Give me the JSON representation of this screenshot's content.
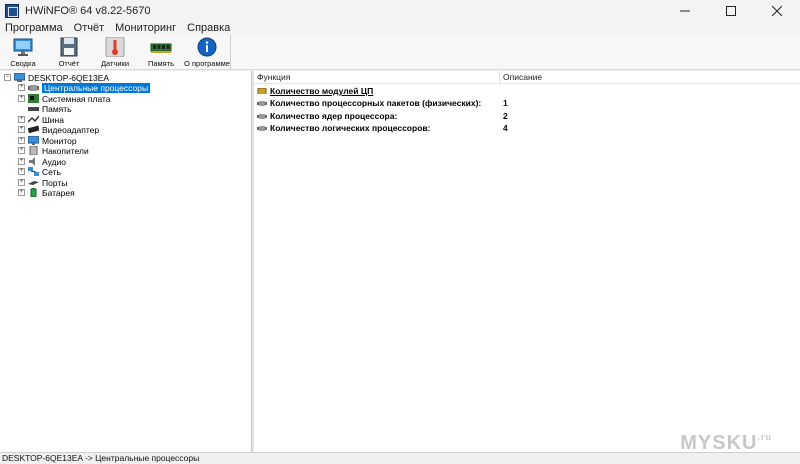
{
  "window": {
    "title": "HWiNFO® 64 v8.22-5670"
  },
  "menu": [
    "Программа",
    "Отчёт",
    "Мониторинг",
    "Справка"
  ],
  "toolbar": {
    "buttons": [
      {
        "label": "Сводка",
        "icon": "monitor-icon"
      },
      {
        "label": "Отчёт",
        "icon": "floppy-disk-icon"
      },
      {
        "label": "Датчики",
        "icon": "thermometer-icon"
      },
      {
        "label": "Память",
        "icon": "memory-module-icon"
      },
      {
        "label": "О программе",
        "icon": "info-icon"
      }
    ]
  },
  "tree": {
    "root": "DESKTOP-6QE13EA",
    "items": [
      {
        "label": "Центральные процессоры",
        "icon": "cpu-icon",
        "selected": true
      },
      {
        "label": "Системная плата",
        "icon": "motherboard-icon"
      },
      {
        "label": "Память",
        "icon": "memory-icon"
      },
      {
        "label": "Шина",
        "icon": "bus-icon"
      },
      {
        "label": "Видеоадаптер",
        "icon": "gpu-icon"
      },
      {
        "label": "Монитор",
        "icon": "monitor-icon"
      },
      {
        "label": "Накопители",
        "icon": "drive-icon"
      },
      {
        "label": "Аудио",
        "icon": "speaker-icon"
      },
      {
        "label": "Сеть",
        "icon": "network-icon"
      },
      {
        "label": "Порты",
        "icon": "port-icon"
      },
      {
        "label": "Батарея",
        "icon": "battery-icon"
      }
    ]
  },
  "list": {
    "headers": {
      "name": "Функция",
      "value": "Описание"
    },
    "rows": [
      {
        "name": "Количество модулей ЦП",
        "value": ""
      },
      {
        "name": "Количество процессорных пакетов (физических):",
        "value": "1"
      },
      {
        "name": "Количество ядер процессора:",
        "value": "2"
      },
      {
        "name": "Количество логических процессоров:",
        "value": "4"
      }
    ]
  },
  "status": {
    "text": "DESKTOP-6QE13EA -> Центральные процессоры"
  },
  "watermark": {
    "text": "MYSKU",
    "suffix": ".ru"
  },
  "colors": {
    "selection": "#0078d7"
  }
}
